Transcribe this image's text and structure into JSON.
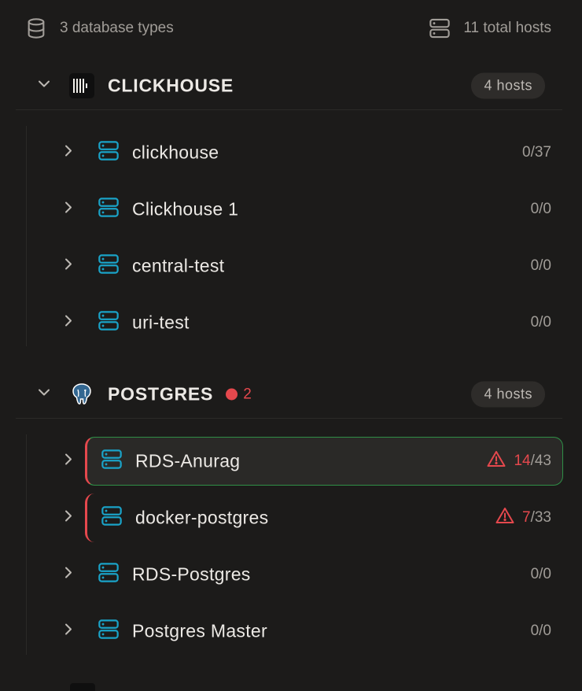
{
  "summary": {
    "db_types": "3 database types",
    "total_hosts": "11 total hosts",
    "icon_db": "database-icon",
    "icon_server": "server-icon"
  },
  "groups": [
    {
      "name": "CLICKHOUSE",
      "logo": "clickhouse-logo",
      "hosts_label": "4 hosts",
      "hosts": [
        {
          "name": "clickhouse",
          "count": "0/37"
        },
        {
          "name": "Clickhouse 1",
          "count": "0/0"
        },
        {
          "name": "central-test",
          "count": "0/0"
        },
        {
          "name": "uri-test",
          "count": "0/0"
        }
      ]
    },
    {
      "name": "POSTGRES",
      "logo": "postgres-elephant-logo",
      "alert_count": "2",
      "hosts_label": "4 hosts",
      "hosts": [
        {
          "name": "RDS-Anurag",
          "bad": "14",
          "total": "/43",
          "selected": true
        },
        {
          "name": "docker-postgres",
          "bad": "7",
          "total": "/33"
        },
        {
          "name": "RDS-Postgres",
          "count": "0/0"
        },
        {
          "name": "Postgres Master",
          "count": "0/0"
        }
      ]
    }
  ],
  "colors": {
    "background": "#1c1b1a",
    "accent_icon": "#1aa3c8",
    "alert": "#e5484d",
    "selected_border": "#2f8f47"
  }
}
